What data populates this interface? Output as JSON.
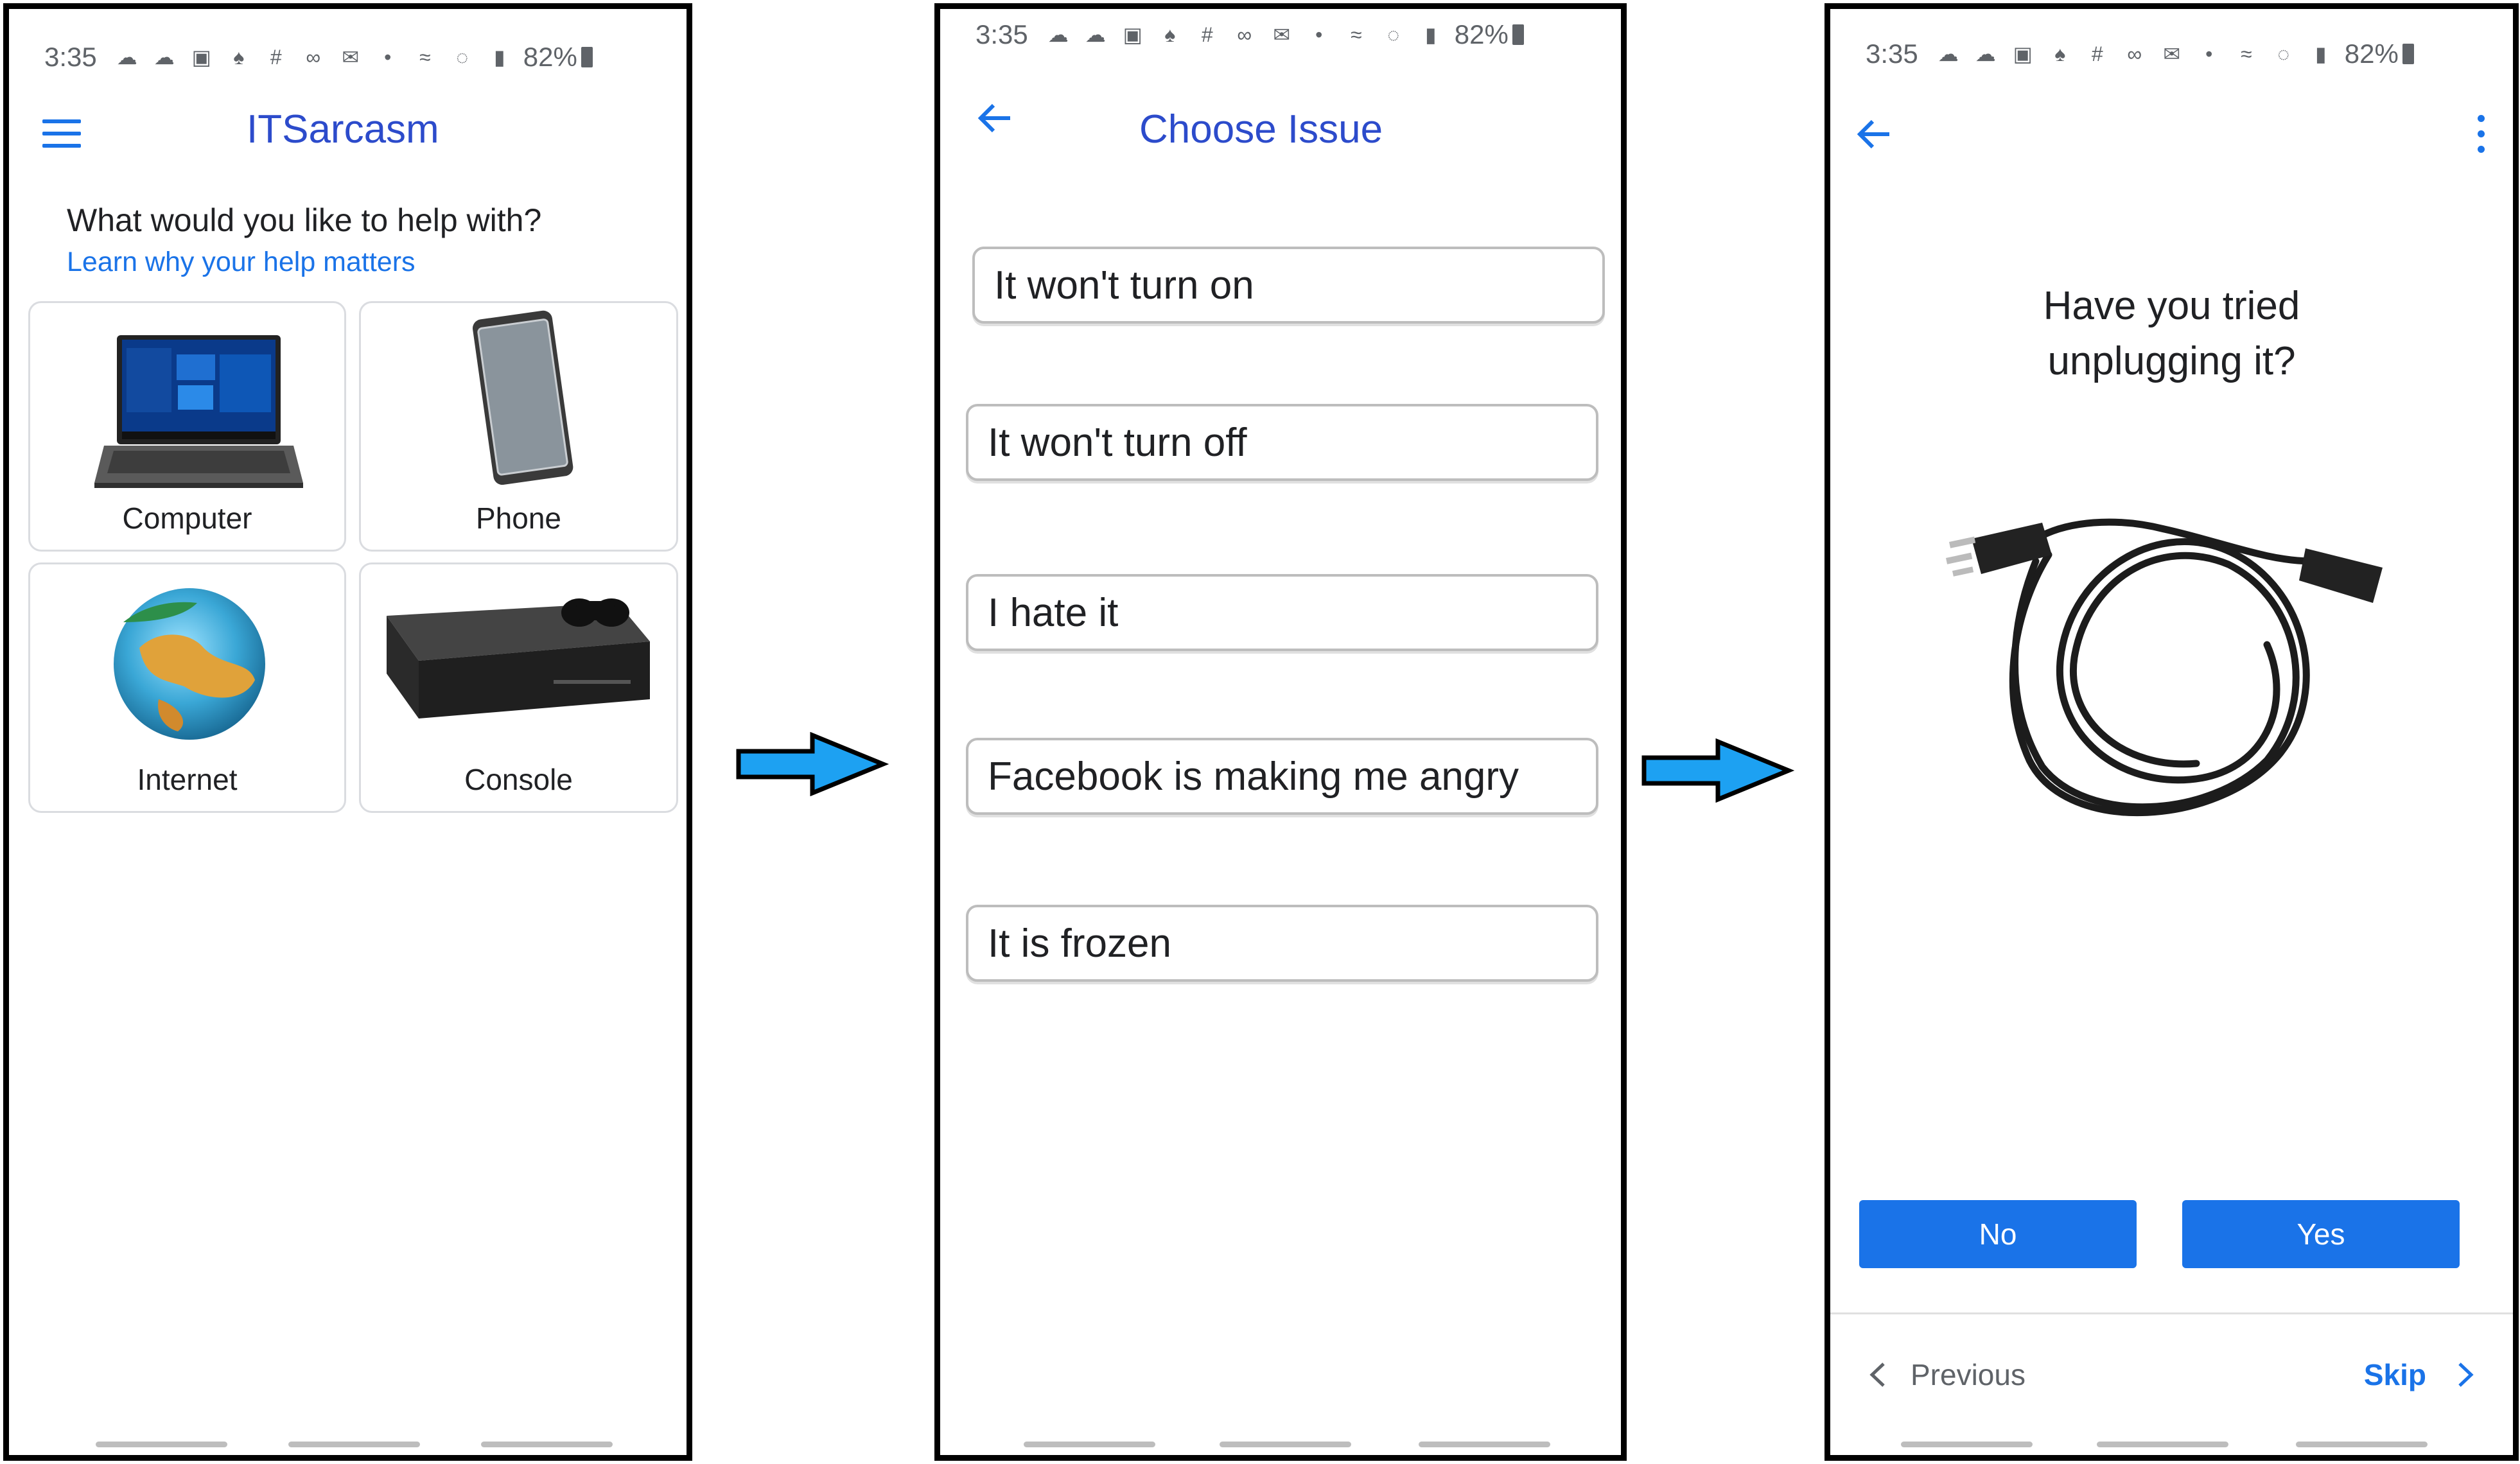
{
  "colors": {
    "accent": "#1a73e8",
    "title_blue": "#2c4bcb",
    "arrow_fill": "#1da1f2",
    "card_border": "#dadce0"
  },
  "status_bar": {
    "time": "3:35",
    "battery": "82%",
    "icons": [
      "cloud-icon",
      "cloud-icon",
      "chat-icon",
      "snapchat-icon",
      "slack-icon",
      "voicemail-icon",
      "mail-icon",
      "dot-icon",
      "wifi-icon",
      "volte-icon",
      "signal-icon",
      "battery-icon"
    ]
  },
  "screen1": {
    "app_title": "ITSarcasm",
    "heading": "What would you like to help with?",
    "link": "Learn why your help matters",
    "categories": [
      {
        "label": "Computer",
        "icon": "laptop-image"
      },
      {
        "label": "Phone",
        "icon": "phone-image"
      },
      {
        "label": "Internet",
        "icon": "globe-image"
      },
      {
        "label": "Console",
        "icon": "console-image"
      }
    ]
  },
  "screen2": {
    "title": "Choose Issue",
    "issues": [
      "It won't turn on",
      "It won't turn off",
      "I hate it",
      "Facebook is making me angry",
      "It is frozen"
    ]
  },
  "screen3": {
    "prompt_line1": "Have you tried",
    "prompt_line2": "unplugging it?",
    "image": "power-cord-image",
    "no_label": "No",
    "yes_label": "Yes",
    "previous_label": "Previous",
    "skip_label": "Skip"
  }
}
